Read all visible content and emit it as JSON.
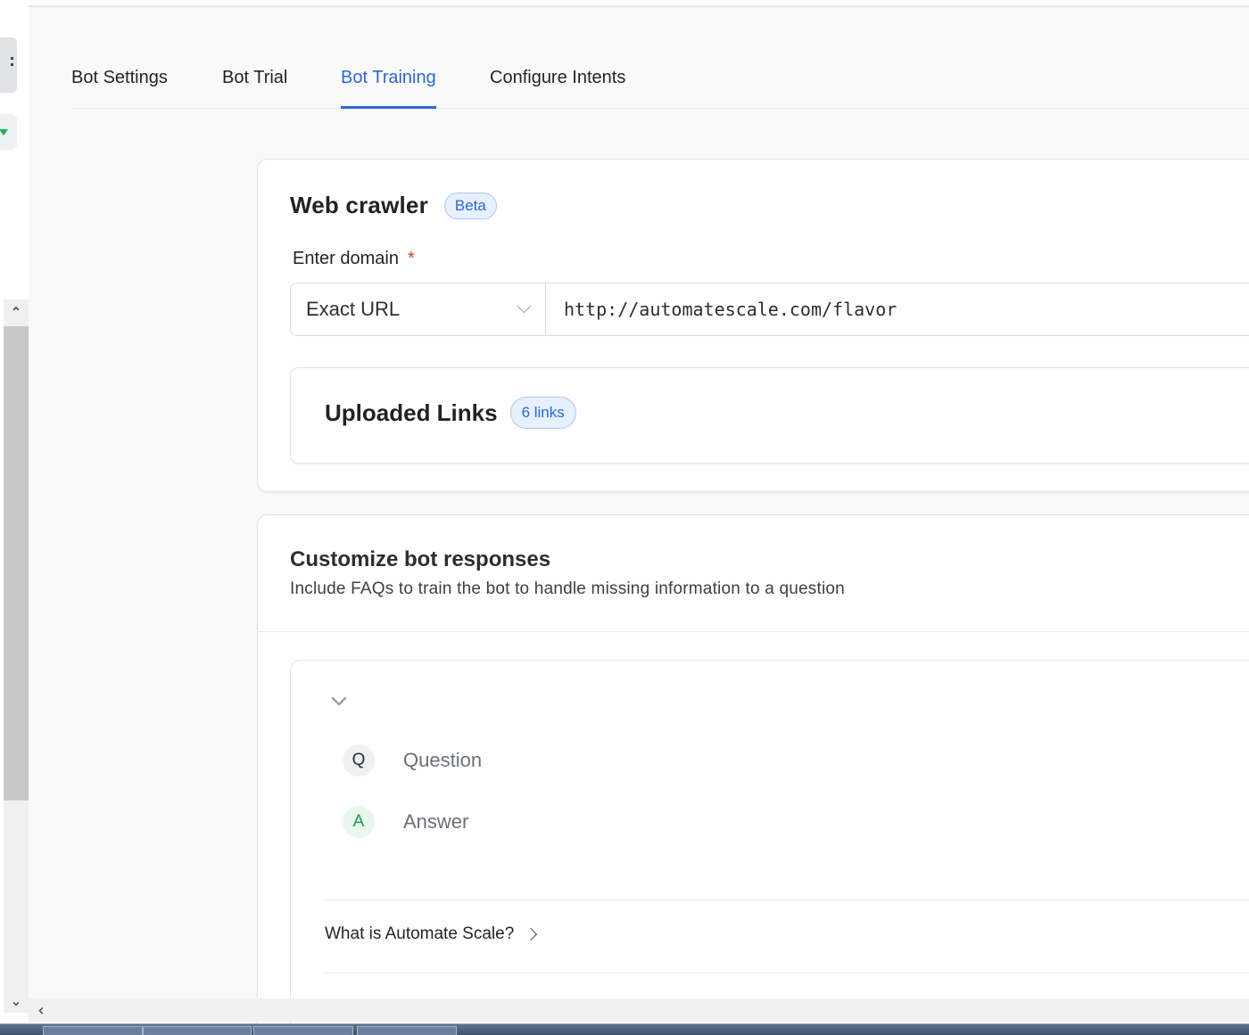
{
  "tabs": [
    {
      "label": "Bot Settings",
      "active": false
    },
    {
      "label": "Bot Trial",
      "active": false
    },
    {
      "label": "Bot Training",
      "active": true
    },
    {
      "label": "Configure Intents",
      "active": false
    }
  ],
  "web_crawler": {
    "title": "Web crawler",
    "badge": "Beta",
    "domain_label": "Enter domain",
    "required_mark": "*",
    "match_type": "Exact URL",
    "url_value": "http://automatescale.com/flavor"
  },
  "uploaded_links": {
    "title": "Uploaded Links",
    "count_badge": "6 links"
  },
  "customize": {
    "title": "Customize bot responses",
    "subtitle": "Include FAQs to train the bot to handle missing information to a question",
    "q_badge": "Q",
    "a_badge": "A",
    "question_placeholder": "Question",
    "answer_placeholder": "Answer",
    "faq_items": [
      "What is Automate Scale?"
    ]
  },
  "colors": {
    "accent": "#2b67d6",
    "required": "#d9382b",
    "answer_green": "#1e9b4c"
  }
}
